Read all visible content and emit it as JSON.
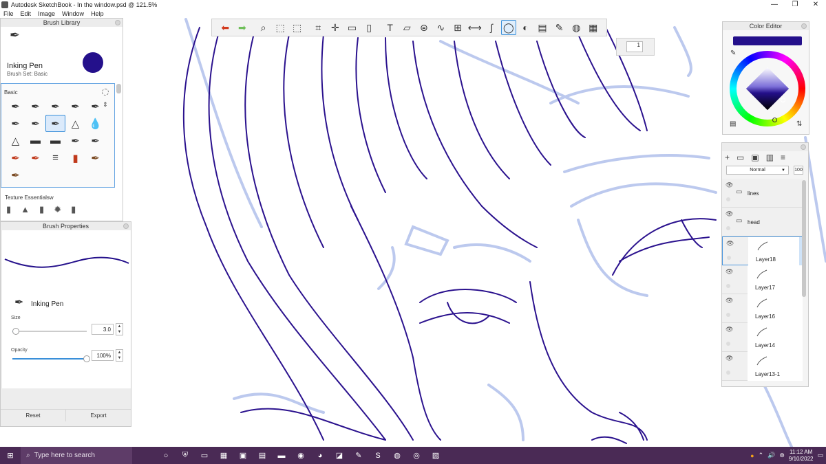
{
  "window": {
    "title": "Autodesk SketchBook - In the window.psd @ 121.5%",
    "minimize": "—",
    "maximize": "❐",
    "close": "✕"
  },
  "menu": [
    "File",
    "Edit",
    "Image",
    "Window",
    "Help"
  ],
  "toolbar": {
    "icons": [
      "undo-icon",
      "redo-icon",
      "zoom-icon",
      "select-rect-icon",
      "select-lasso-icon",
      "crop-icon",
      "transform-icon",
      "distort-icon",
      "fill-bucket-icon",
      "text-icon",
      "ruler-icon",
      "ellipse-guide-icon",
      "french-curve-icon",
      "perspective-icon",
      "symmetry-icon",
      "stroke-icon",
      "predictive-stroke-icon",
      "shapes-icon",
      "copy-paste-icon",
      "brush-palette-icon",
      "color-wheel-icon",
      "layers-icon"
    ],
    "glyphs": [
      "⬅",
      "➡",
      "⌕",
      "⬚",
      "⬚",
      "⌗",
      "✛",
      "▭",
      "▯",
      "T",
      "▱",
      "⊜",
      "∿",
      "⊞",
      "⟷",
      "∫",
      "◯",
      "◐",
      "▤",
      "✎",
      "◍",
      "▦"
    ],
    "active_index": 16
  },
  "floating_counter": "1",
  "brush_library": {
    "title": "Brush Library",
    "brush_name": "Inking Pen",
    "brush_set": "Brush Set: Basic",
    "current_color": "#24108b",
    "section": "Basic",
    "texture_section": "Texture Essentialsw",
    "brush_icons": [
      "✒",
      "✒",
      "✒",
      "✒",
      "✒",
      "✒",
      "✒",
      "✒",
      "△",
      "💧",
      "△",
      "▬",
      "▬",
      "✒",
      "✒",
      "✒",
      "✒",
      "≡",
      "▮",
      "✒",
      "✒"
    ],
    "selected_index": 7
  },
  "brush_properties": {
    "title": "Brush Properties",
    "brush_name": "Inking Pen",
    "size_label": "Size",
    "size_value": "3.0",
    "size_fraction": 0.05,
    "opacity_label": "Opacity",
    "opacity_value": "100%",
    "opacity_fraction": 1.0,
    "reset_label": "Reset",
    "export_label": "Export"
  },
  "color_editor": {
    "title": "Color Editor",
    "color": "#24108b"
  },
  "layer_editor": {
    "blend_mode": "Normal",
    "opacity": "100",
    "layers": [
      {
        "name": "lines",
        "type": "group"
      },
      {
        "name": "head",
        "type": "group"
      },
      {
        "name": "Layer18",
        "type": "layer",
        "selected": true
      },
      {
        "name": "Layer17",
        "type": "layer"
      },
      {
        "name": "Layer16",
        "type": "layer"
      },
      {
        "name": "Layer14",
        "type": "layer"
      },
      {
        "name": "Layer13-1",
        "type": "layer"
      }
    ]
  },
  "taskbar": {
    "search_placeholder": "Type here to search",
    "time": "11:12 AM",
    "date": "9/10/2022"
  }
}
